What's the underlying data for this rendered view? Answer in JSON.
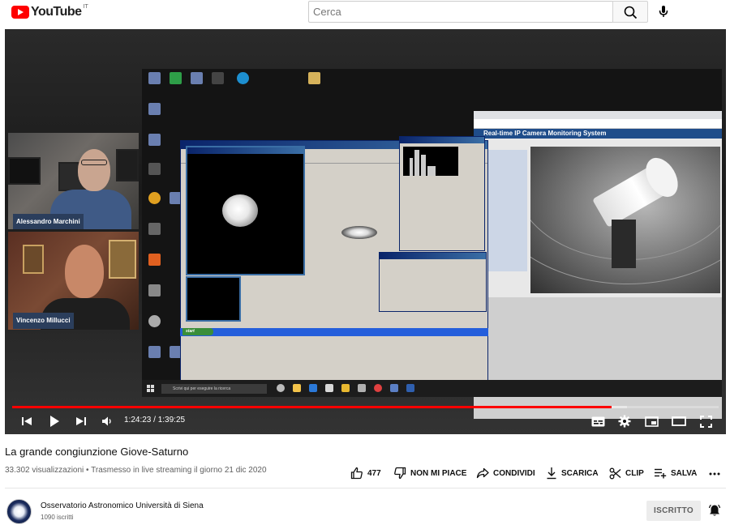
{
  "header": {
    "logo_text": "YouTube",
    "country_code": "IT",
    "search_placeholder": "Cerca"
  },
  "video": {
    "participants": [
      {
        "name": "Alessandro Marchini"
      },
      {
        "name": "Vincenzo Millucci"
      }
    ],
    "screen": {
      "camera_header": "Real-time IP Camera Monitoring System",
      "taskbar_search": "Scrivi qui per eseguire la ricerca",
      "xp_start": "start"
    },
    "player": {
      "current_time": "1:24:23",
      "duration": "1:39:25",
      "time_display": "1:24:23 / 1:39:25",
      "progress_fraction": 0.849,
      "buffer_fraction": 0.87
    }
  },
  "info": {
    "title": "La grande congiunzione Giove-Saturno",
    "meta": "33.302 visualizzazioni • Trasmesso in live streaming il giorno 21 dic 2020",
    "actions": {
      "like_count": "477",
      "dislike_label": "NON MI PIACE",
      "share_label": "CONDIVIDI",
      "download_label": "SCARICA",
      "clip_label": "CLIP",
      "save_label": "SALVA"
    }
  },
  "channel": {
    "name": "Osservatorio Astronomico Università di Siena",
    "subscribers": "1090 iscritti",
    "subscribe_label": "ISCRITTO"
  },
  "colors": {
    "brand_red": "#ff0000",
    "name_tag_bg": "#2b3e5c",
    "text_primary": "#0f0f0f",
    "text_secondary": "#606060"
  }
}
